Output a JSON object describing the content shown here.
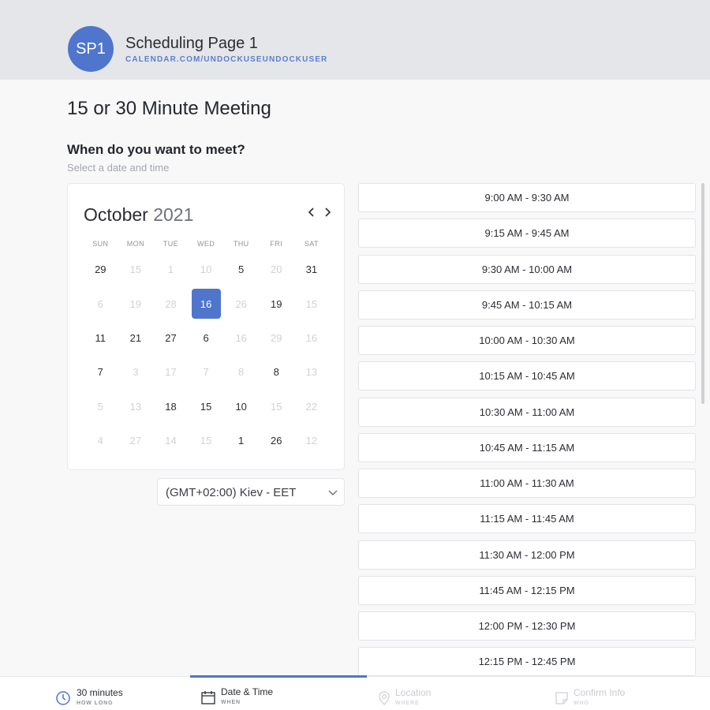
{
  "header": {
    "avatar_initials": "SP1",
    "page_name": "Scheduling Page 1",
    "page_url": "CALENDAR.COM/UNDOCKUSEUNDOCKUSER"
  },
  "meeting_title": "15 or 30 Minute Meeting",
  "question": "When do you want to meet?",
  "subtitle": "Select a date and time",
  "calendar": {
    "month": "October",
    "year": "2021",
    "weekdays": [
      "SUN",
      "MON",
      "TUE",
      "WED",
      "THU",
      "FRI",
      "SAT"
    ],
    "days": [
      {
        "label": "29",
        "muted": false
      },
      {
        "label": "15",
        "muted": true
      },
      {
        "label": "1",
        "muted": true
      },
      {
        "label": "10",
        "muted": true
      },
      {
        "label": "5",
        "muted": false
      },
      {
        "label": "20",
        "muted": true
      },
      {
        "label": "31",
        "muted": false
      },
      {
        "label": "6",
        "muted": true
      },
      {
        "label": "19",
        "muted": true
      },
      {
        "label": "28",
        "muted": true
      },
      {
        "label": "16",
        "muted": false,
        "selected": true
      },
      {
        "label": "26",
        "muted": true
      },
      {
        "label": "19",
        "muted": false
      },
      {
        "label": "15",
        "muted": true
      },
      {
        "label": "11",
        "muted": false
      },
      {
        "label": "21",
        "muted": false
      },
      {
        "label": "27",
        "muted": false
      },
      {
        "label": "6",
        "muted": false
      },
      {
        "label": "16",
        "muted": true
      },
      {
        "label": "29",
        "muted": true
      },
      {
        "label": "16",
        "muted": true
      },
      {
        "label": "7",
        "muted": false
      },
      {
        "label": "3",
        "muted": true
      },
      {
        "label": "17",
        "muted": true
      },
      {
        "label": "7",
        "muted": true
      },
      {
        "label": "8",
        "muted": true
      },
      {
        "label": "8",
        "muted": false
      },
      {
        "label": "13",
        "muted": true
      },
      {
        "label": "5",
        "muted": true
      },
      {
        "label": "13",
        "muted": true
      },
      {
        "label": "18",
        "muted": false
      },
      {
        "label": "15",
        "muted": false
      },
      {
        "label": "10",
        "muted": false
      },
      {
        "label": "15",
        "muted": true
      },
      {
        "label": "22",
        "muted": true
      },
      {
        "label": "4",
        "muted": true
      },
      {
        "label": "27",
        "muted": true
      },
      {
        "label": "14",
        "muted": true
      },
      {
        "label": "15",
        "muted": true
      },
      {
        "label": "1",
        "muted": false
      },
      {
        "label": "26",
        "muted": false
      },
      {
        "label": "12",
        "muted": true
      }
    ]
  },
  "timezone": "(GMT+02:00) Kiev - EET",
  "time_slots": [
    "9:00 AM - 9:30 AM",
    "9:15 AM - 9:45 AM",
    "9:30 AM - 10:00 AM",
    "9:45 AM - 10:15 AM",
    "10:00 AM - 10:30 AM",
    "10:15 AM - 10:45 AM",
    "10:30 AM - 11:00 AM",
    "10:45 AM - 11:15 AM",
    "11:00 AM - 11:30 AM",
    "11:15 AM - 11:45 AM",
    "11:30 AM - 12:00 PM",
    "11:45 AM - 12:15 PM",
    "12:00 PM - 12:30 PM",
    "12:15 PM - 12:45 PM"
  ],
  "steps": [
    {
      "title": "30 minutes",
      "sub": "HOW LONG",
      "icon": "clock-icon"
    },
    {
      "title": "Date & Time",
      "sub": "WHEN",
      "icon": "calendar-icon"
    },
    {
      "title": "Location",
      "sub": "WHERE",
      "icon": "location-pin-icon"
    },
    {
      "title": "Confirm Info",
      "sub": "WHO",
      "icon": "note-icon"
    }
  ],
  "colors": {
    "accent": "#4f76cc",
    "header_bg": "#e5e6ea"
  }
}
